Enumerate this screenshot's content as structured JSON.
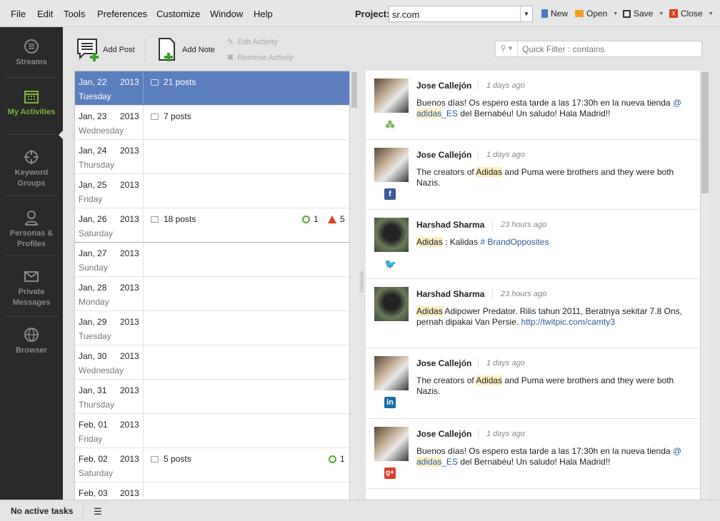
{
  "menu": [
    "File",
    "Edit",
    "Tools",
    "Preferences",
    "Customize",
    "Window",
    "Help"
  ],
  "project": {
    "label": "Project:",
    "value": "sr.com"
  },
  "file_actions": {
    "new": "New",
    "open": "Open",
    "save": "Save",
    "close": "Close"
  },
  "sidebar": [
    {
      "label": "Streams"
    },
    {
      "label": "My Activities"
    },
    {
      "label": "Keyword Groups"
    },
    {
      "label": "Personas & Profiles"
    },
    {
      "label": "Private Messages"
    },
    {
      "label": "Browser"
    }
  ],
  "toolbar": {
    "add_post": "Add Post",
    "add_note": "Add Note",
    "edit_activity": "Edit Activity",
    "remove_activity": "Remove Activity",
    "filter_placeholder": "Quick Filter : contains"
  },
  "calendar": [
    {
      "date": "Jan, 22",
      "year": "2013",
      "day": "Tuesday",
      "posts": "21 posts"
    },
    {
      "date": "Jan, 23",
      "year": "2013",
      "day": "Wednesday",
      "posts": "7 posts"
    },
    {
      "date": "Jan, 24",
      "year": "2013",
      "day": "Thursday"
    },
    {
      "date": "Jan, 25",
      "year": "2013",
      "day": "Friday"
    },
    {
      "date": "Jan, 26",
      "year": "2013",
      "day": "Saturday",
      "posts": "18 posts",
      "scheduled": "1",
      "alerts": "5"
    },
    {
      "date": "Jan, 27",
      "year": "2013",
      "day": "Sunday"
    },
    {
      "date": "Jan, 28",
      "year": "2013",
      "day": "Monday"
    },
    {
      "date": "Jan, 29",
      "year": "2013",
      "day": "Tuesday"
    },
    {
      "date": "Jan, 30",
      "year": "2013",
      "day": "Wednesday"
    },
    {
      "date": "Jan, 31",
      "year": "2013",
      "day": "Thursday"
    },
    {
      "date": "Feb, 01",
      "year": "2013",
      "day": "Friday"
    },
    {
      "date": "Feb, 02",
      "year": "2013",
      "day": "Saturday",
      "posts": "5 posts",
      "scheduled": "1"
    },
    {
      "date": "Feb, 03",
      "year": "2013",
      "day": ""
    }
  ],
  "feed": [
    {
      "author": "Jose Callejón",
      "time": "1 days ago",
      "network": "community"
    },
    {
      "author": "Jose Callejón",
      "time": "1 days ago",
      "network": "facebook"
    },
    {
      "author": "Harshad Sharma",
      "time": "23 hours ago",
      "network": "twitter"
    },
    {
      "author": "Harshad Sharma",
      "time": "23 hours ago",
      "network": "none"
    },
    {
      "author": "Jose Callejón",
      "time": "1 days ago",
      "network": "linkedin"
    },
    {
      "author": "Jose Callejón",
      "time": "1 days ago",
      "network": "google-plus"
    }
  ],
  "texts": {
    "t1a": "Buenos días! Os espero esta tarde a las 17:30h en la nueva tienda ",
    "t1b": "@ ",
    "t1c": "adidas",
    "t1d": "_ES",
    "t1e": " del Bernabéu! Un saludo! Hala Madrid!!",
    "t2a": "The creators of ",
    "t2b": "Adidas",
    "t2c": " and Puma were brothers and they were both Nazis.",
    "t3a": "Adidas",
    "t3b": " : Kalidas ",
    "t3c": "# BrandOpposites",
    "t4a": "Adidas",
    "t4b": " Adipower Predator. Rilis tahun 2011, Beratnya sekitar 7.8 Ons, pernah dipakai Van Persie. ",
    "t4c": "http://twitpic.com/camty3"
  },
  "status": {
    "text": "No active tasks"
  }
}
